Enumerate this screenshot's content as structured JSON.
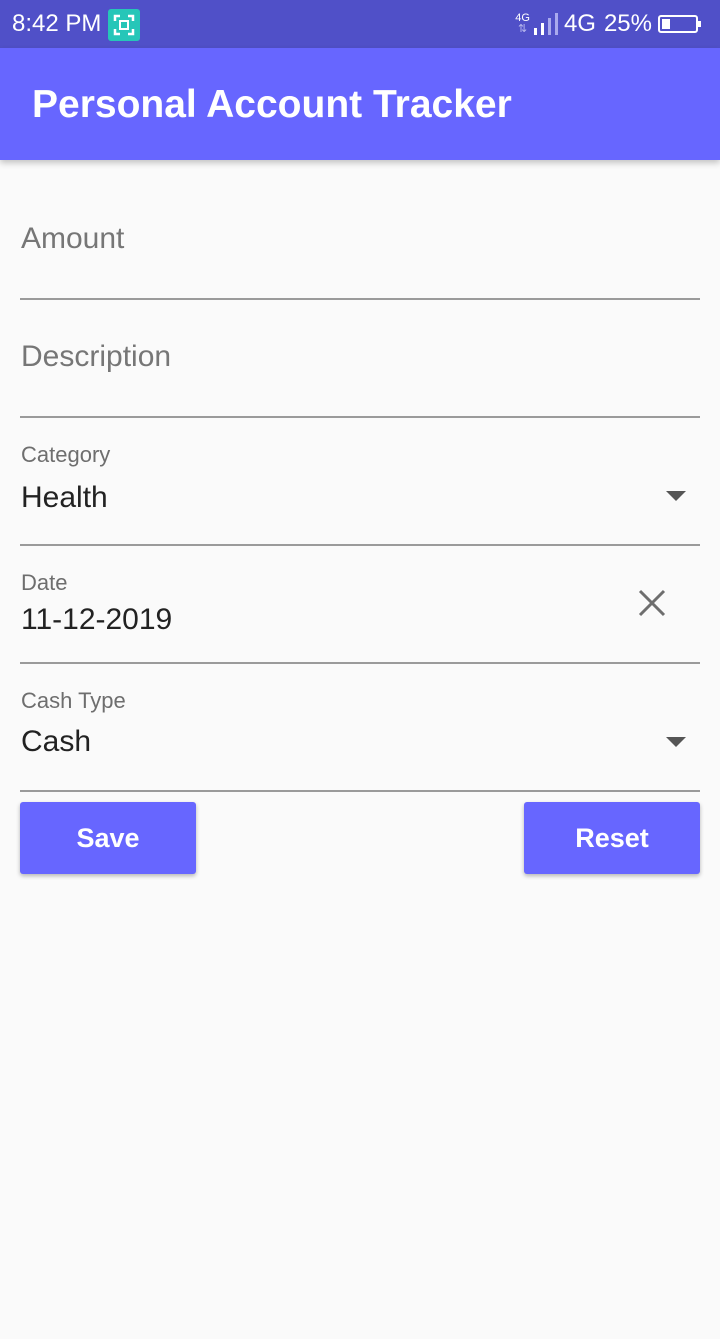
{
  "status_bar": {
    "time": "8:42 PM",
    "network_small": "4G",
    "network": "4G",
    "battery": "25%",
    "icons": [
      "screenshot-icon",
      "signal-icon",
      "battery-icon"
    ]
  },
  "app_bar": {
    "title": "Personal Account Tracker",
    "color": "#6766ff"
  },
  "form": {
    "amount": {
      "placeholder": "Amount",
      "value": ""
    },
    "description": {
      "placeholder": "Description",
      "value": ""
    },
    "category": {
      "label": "Category",
      "value": "Health"
    },
    "date": {
      "label": "Date",
      "value": "11-12-2019"
    },
    "cash_type": {
      "label": "Cash Type",
      "value": "Cash"
    }
  },
  "buttons": {
    "save": "Save",
    "reset": "Reset"
  },
  "colors": {
    "status_bar": "#5050c8",
    "accent": "#6766ff",
    "background": "#fafafa"
  }
}
